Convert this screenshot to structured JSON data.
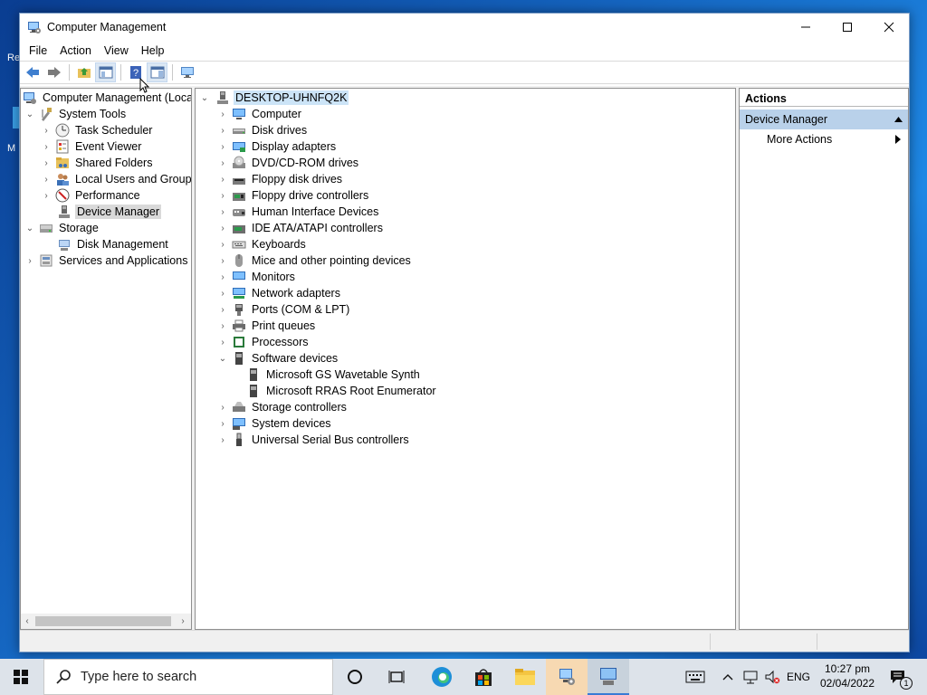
{
  "desktop": {
    "icon_label_1": "Re",
    "icon_label_2": "M"
  },
  "window": {
    "title": "Computer Management",
    "minimize": "—",
    "maximize": "☐",
    "close": "✕"
  },
  "menu": [
    "File",
    "Action",
    "View",
    "Help"
  ],
  "toolbar": [
    "back-icon",
    "forward-icon",
    "up-folder-icon",
    "show-hide-tree-icon",
    "help-icon",
    "action-pane-icon",
    "monitor-icon"
  ],
  "tree": {
    "root": "Computer Management (Local",
    "system_tools": "System Tools",
    "task_scheduler": "Task Scheduler",
    "event_viewer": "Event Viewer",
    "shared_folders": "Shared Folders",
    "local_users": "Local Users and Groups",
    "performance": "Performance",
    "device_manager": "Device Manager",
    "storage": "Storage",
    "disk_management": "Disk Management",
    "services": "Services and Applications"
  },
  "devices": {
    "root": "DESKTOP-UHNFQ2K",
    "items": [
      "Computer",
      "Disk drives",
      "Display adapters",
      "DVD/CD-ROM drives",
      "Floppy disk drives",
      "Floppy drive controllers",
      "Human Interface Devices",
      "IDE ATA/ATAPI controllers",
      "Keyboards",
      "Mice and other pointing devices",
      "Monitors",
      "Network adapters",
      "Ports (COM & LPT)",
      "Print queues",
      "Processors",
      "Software devices",
      "Microsoft GS Wavetable Synth",
      "Microsoft RRAS Root Enumerator",
      "Storage controllers",
      "System devices",
      "Universal Serial Bus controllers"
    ]
  },
  "actions": {
    "header": "Actions",
    "section": "Device Manager",
    "more": "More Actions"
  },
  "taskbar": {
    "search_placeholder": "Type here to search",
    "language": "ENG",
    "time": "10:27 pm",
    "date": "02/04/2022",
    "notification_count": "1"
  },
  "colors": {
    "selection_blue": "#cce4f7",
    "actions_header_blue": "#b9d1ea",
    "taskbar": "#dde3ea"
  }
}
